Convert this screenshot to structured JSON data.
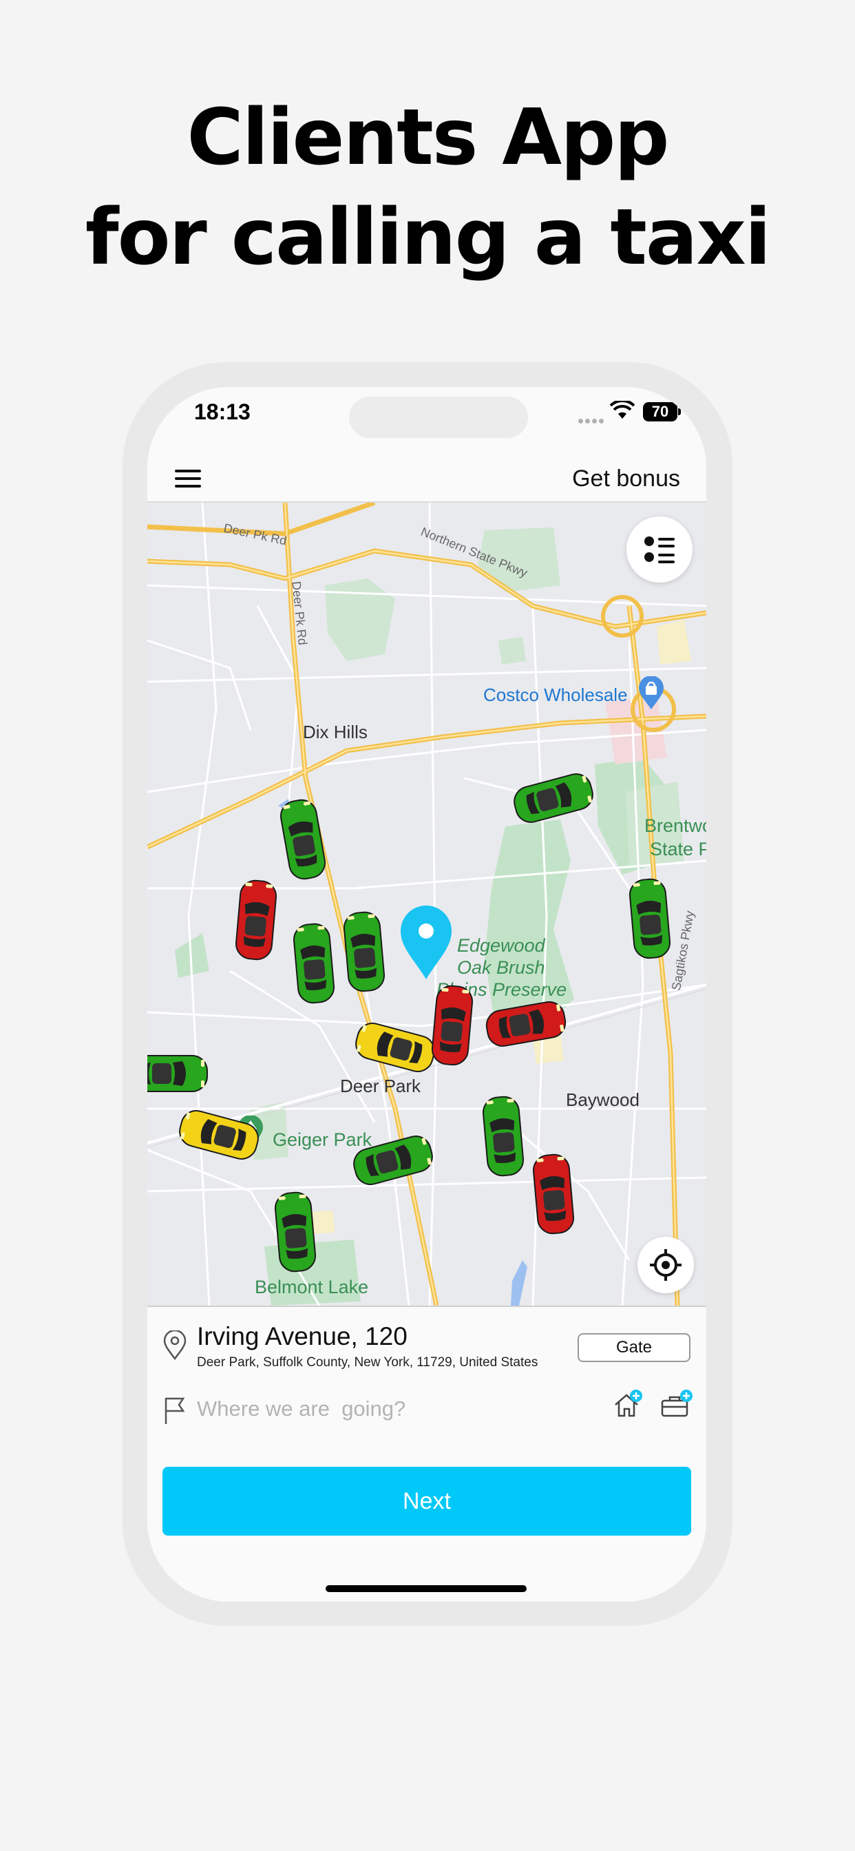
{
  "headline": {
    "line1": "Clients App",
    "line2": "for calling a taxi"
  },
  "status_bar": {
    "time": "18:13",
    "battery": "70"
  },
  "navbar": {
    "menu_icon": "hamburger-icon",
    "bonus_label": "Get bonus"
  },
  "map": {
    "places": {
      "dix_hills": "Dix Hills",
      "costco": "Costco Wholesale",
      "brentwood_1": "Brentwo",
      "brentwood_2": "State P",
      "edgewood_1": "Edgewood",
      "edgewood_2": "Oak Brush",
      "edgewood_3": "Plains Preserve",
      "deer_park": "Deer Park",
      "baywood": "Baywood",
      "geiger_park": "Geiger Park",
      "belmont_lake": "Belmont Lake"
    },
    "roads": {
      "deer_pk_rd_1": "Deer Pk Rd",
      "deer_pk_rd_2": "Deer Pk Rd",
      "northern_state": "Northern State Pkwy",
      "sagtikos": "Sagtikos Pkwy"
    },
    "car_colors": {
      "green": "#27a61e",
      "red": "#d11a1a",
      "yellow": "#f2d318"
    }
  },
  "address": {
    "main": "Irving Avenue, 120",
    "sub": "Deer Park, Suffolk County, New York, 11729, United States",
    "gate_label": "Gate"
  },
  "destination": {
    "placeholder": "Where we are  going?",
    "value": ""
  },
  "next_label": "Next",
  "colors": {
    "accent": "#00c8f8",
    "pin": "#19c4f2"
  }
}
